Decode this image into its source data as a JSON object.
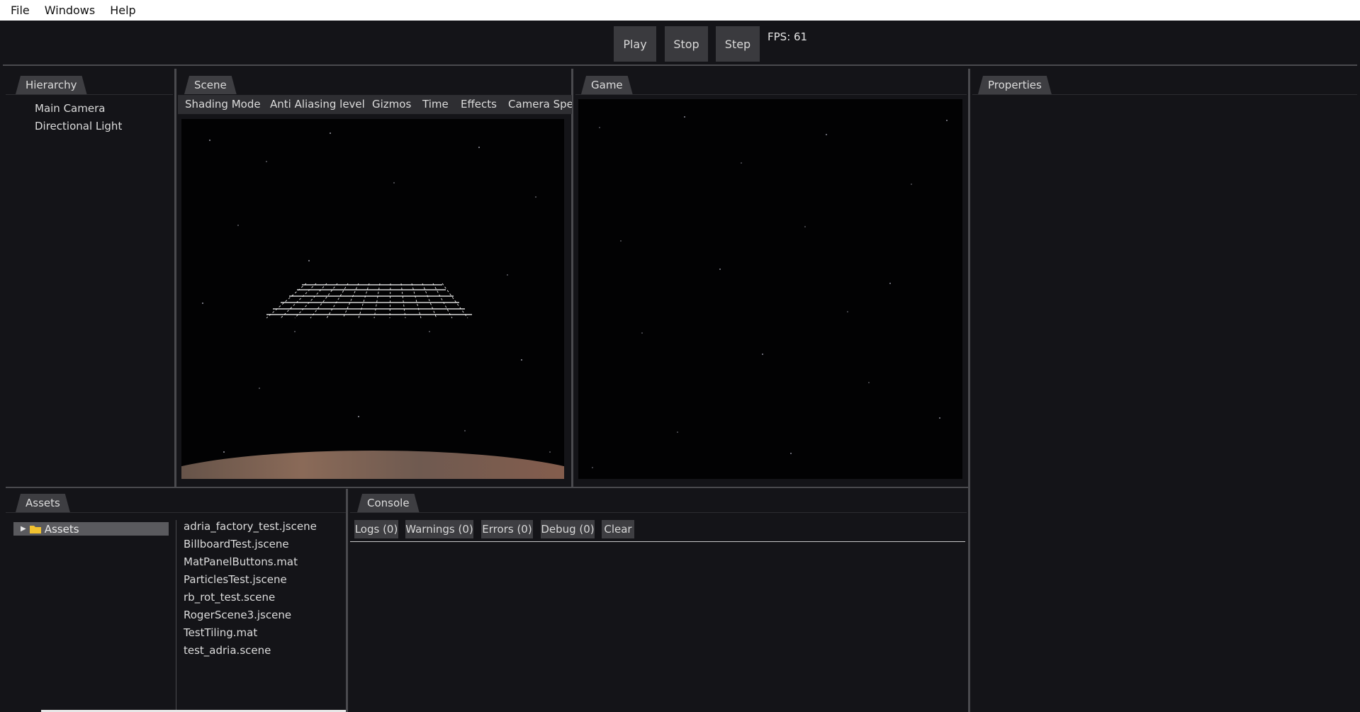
{
  "menubar": {
    "items": [
      "File",
      "Windows",
      "Help"
    ]
  },
  "toolbar": {
    "play": "Play",
    "stop": "Stop",
    "step": "Step",
    "fps": "FPS: 61"
  },
  "hierarchy": {
    "tab": "Hierarchy",
    "items": [
      "Main Camera",
      "Directional Light"
    ]
  },
  "scene": {
    "tab": "Scene",
    "toolbar": [
      "Shading Mode",
      "Anti Aliasing level",
      "Gizmos",
      "Time",
      "Effects",
      "Camera Spee"
    ]
  },
  "game": {
    "tab": "Game"
  },
  "properties": {
    "tab": "Properties"
  },
  "assets": {
    "tab": "Assets",
    "root": "Assets",
    "files": [
      "adria_factory_test.jscene",
      "BillboardTest.jscene",
      "MatPanelButtons.mat",
      "ParticlesTest.jscene",
      "rb_rot_test.scene",
      "RogerScene3.jscene",
      "TestTiling.mat",
      "test_adria.scene"
    ]
  },
  "console": {
    "tab": "Console",
    "logs": "Logs (0)",
    "warnings": "Warnings (0)",
    "errors": "Errors (0)",
    "debug": "Debug (0)",
    "clear": "Clear"
  },
  "colors": {
    "background": "#141418",
    "panel_tab": "#3e3e42",
    "button": "#3a3a3e",
    "menubar": "#ffffff",
    "viewport": "#020203",
    "folder": "#f2c230"
  },
  "icons": [
    "triangle-right-icon",
    "folder-icon"
  ]
}
